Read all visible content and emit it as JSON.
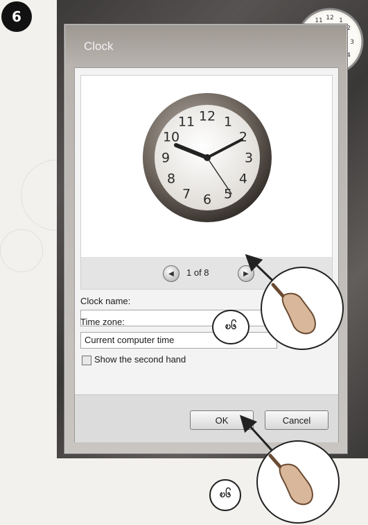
{
  "step": {
    "label": "6"
  },
  "dialog": {
    "title": "Clock",
    "pager": {
      "text": "1 of 8"
    },
    "clock_name": {
      "label": "Clock name:",
      "value": ""
    },
    "time_zone": {
      "label": "Time zone:",
      "value": "Current computer time"
    },
    "second_hand": {
      "label": "Show the second hand",
      "checked": false
    },
    "buttons": {
      "ok": "OK",
      "cancel": "Cancel"
    }
  },
  "annotations": {
    "upper": "ၿ၆",
    "lower": "ၿ၆"
  },
  "clock_face": {
    "numbers": [
      "12",
      "1",
      "2",
      "3",
      "4",
      "5",
      "6",
      "7",
      "8",
      "9",
      "10",
      "11"
    ]
  }
}
